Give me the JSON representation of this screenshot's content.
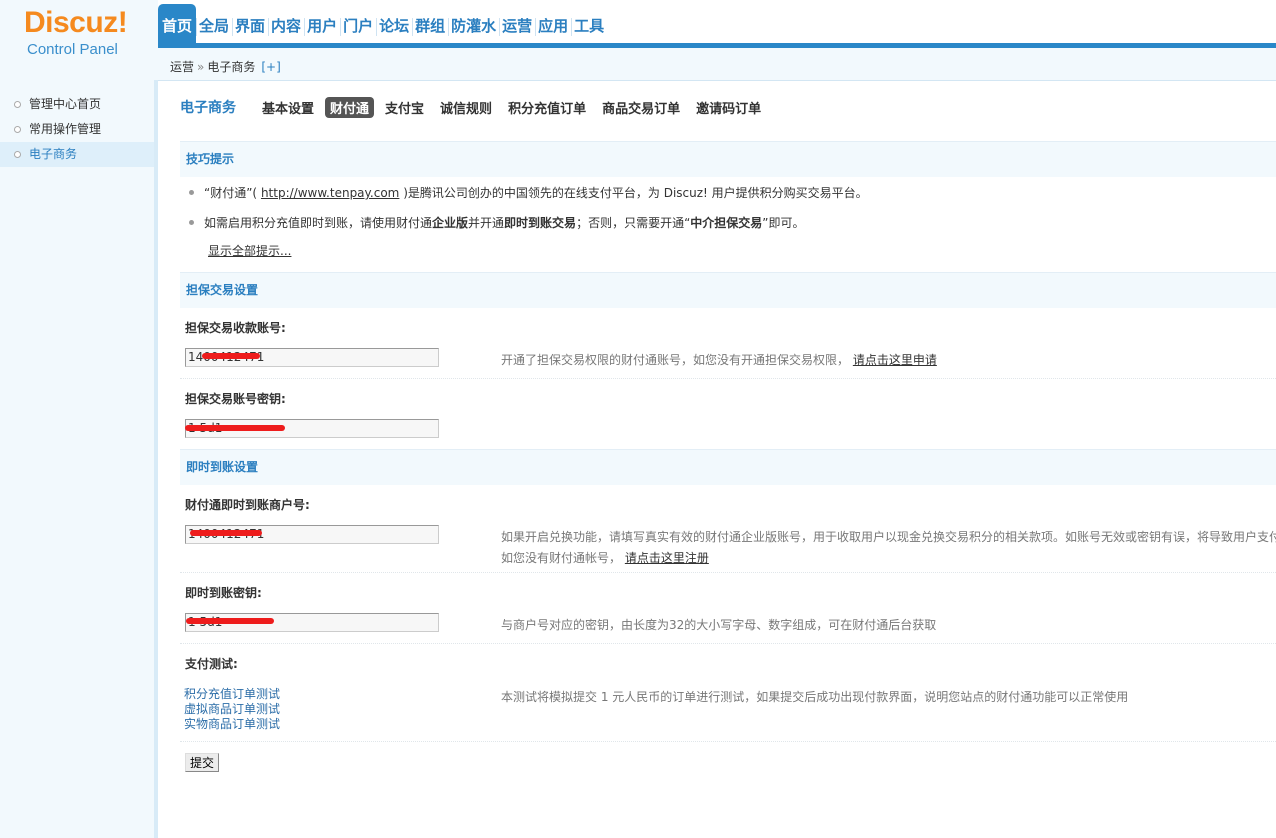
{
  "logo": {
    "brand": "Discuz",
    "brand_mark": "!",
    "sub": "Control Panel"
  },
  "topnav": [
    "首页",
    "全局",
    "界面",
    "内容",
    "用户",
    "门户",
    "论坛",
    "群组",
    "防灌水",
    "运营",
    "应用",
    "工具"
  ],
  "breadcrumb": {
    "parent": "运营",
    "sep": "»",
    "current": "电子商务",
    "plus": "[+]"
  },
  "sidebar": {
    "items": [
      "管理中心首页",
      "常用操作管理",
      "电子商务"
    ]
  },
  "subnav": {
    "title": "电子商务",
    "tabs": [
      "基本设置",
      "财付通",
      "支付宝",
      "诚信规则",
      "积分充值订单",
      "商品交易订单",
      "邀请码订单"
    ]
  },
  "tips": {
    "title": "技巧提示",
    "tip1_a": "“财付通”(",
    "tip1_link": "http://www.tenpay.com",
    "tip1_b": ")是腾讯公司创办的中国领先的在线支付平台，为 Discuz! 用户提供积分购买交易平台。",
    "tip2_a": "如需启用积分充值即时到账，请使用财付通",
    "tip2_b1": "企业版",
    "tip2_c": "并开通",
    "tip2_b2": "即时到账交易",
    "tip2_d": "；否则，只需要开通“",
    "tip2_b3": "中介担保交易",
    "tip2_e": "”即可。",
    "show_all": "显示全部提示..."
  },
  "escrow": {
    "title": "担保交易设置",
    "account_label": "担保交易收款账号:",
    "account_value": "1400412471",
    "account_hint": "开通了担保交易权限的财付通账号，如您没有开通担保交易权限，",
    "account_hint_link": "请点击这里申请",
    "key_label": "担保交易账号密钥:",
    "key_value": "1                   5d1"
  },
  "instant": {
    "title": "即时到账设置",
    "merchant_label": "财付通即时到账商户号:",
    "merchant_value": "1400412471",
    "merchant_hint_1": "如果开启兑换功能，请填写真实有效的财付通企业版账号，用于收取用户以现金兑换交易积分的相关款项。如账号无效或密钥有误，将导致用户支付",
    "merchant_hint_2": "如您没有财付通帐号，",
    "merchant_hint_link": "请点击这里注册",
    "key_label": "即时到账密钥:",
    "key_value": "1                   5d1",
    "key_hint": "与商户号对应的密钥，由长度为32的大小写字母、数字组成，可在财付通后台获取"
  },
  "test": {
    "label": "支付测试:",
    "links": [
      "积分充值订单测试",
      "虚拟商品订单测试",
      "实物商品订单测试"
    ],
    "hint": "本测试将模拟提交 1 元人民币的订单进行测试，如果提交后成功出现付款界面，说明您站点的财付通功能可以正常使用"
  },
  "submit_label": "提交",
  "colors": {
    "accent": "#2a87c8",
    "logo": "#f58a1f",
    "redact": "#ee1c1c"
  }
}
